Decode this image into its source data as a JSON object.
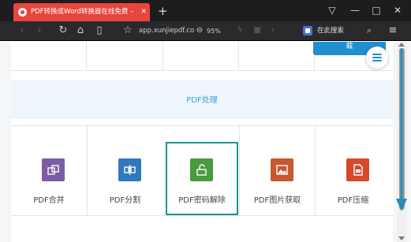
{
  "browser": {
    "tab_title": "PDF转换成Word转换器在线免费 - ✕",
    "tab_title_text": "PDF转换成Word转换器在线免费 –",
    "tab_close": "✕",
    "new_tab": "+",
    "window_buttons": [
      "▽",
      "—",
      "□",
      "✕"
    ],
    "url": "app.xunjiepdf.co",
    "zoom": "95%",
    "search_label": "在此搜索",
    "icons": [
      "back-icon",
      "forward-icon",
      "reload-icon",
      "home-icon",
      "reader-icon",
      "star-icon",
      "zoom-icon",
      "flash-icon",
      "apps-icon",
      "search-icon",
      "menu-icon"
    ]
  },
  "top_strip": {
    "cells": [
      "",
      "",
      "",
      ""
    ],
    "button_label": "载"
  },
  "section": {
    "title": "PDF处理"
  },
  "tools": [
    {
      "label": "PDF合并",
      "color": "#7b5ca6",
      "icon": "merge-icon"
    },
    {
      "label": "PDF分割",
      "color": "#2f79bd",
      "icon": "split-icon"
    },
    {
      "label": "PDF密码解除",
      "color": "#4a9a3f",
      "icon": "unlock-icon",
      "selected": true
    },
    {
      "label": "PDF图片获取",
      "color": "#c8562f",
      "icon": "image-icon"
    },
    {
      "label": "PDF压缩",
      "color": "#d9472d",
      "icon": "compress-icon"
    }
  ],
  "colors": {
    "accent": "#1f8fcf",
    "highlight_border": "#1a9594",
    "tab_red": "#e8453c"
  }
}
